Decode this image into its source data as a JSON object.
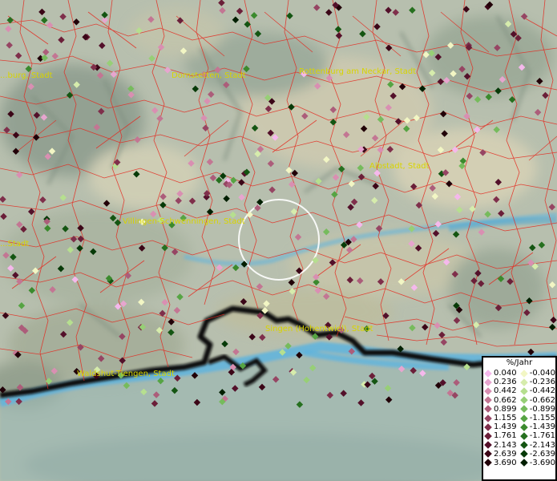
{
  "map": {
    "cities": [
      {
        "name": "...burg, Stadt"
      },
      {
        "name": "Dornstetten, Stadt"
      },
      {
        "name": "Rottenburg am Neckar, Stadt"
      },
      {
        "name": "Albstadt, Stadt"
      },
      {
        "name": "Villingen-Schwenningen, Stadt"
      },
      {
        "name": "...Stadt"
      },
      {
        "name": "Singen (Hohentwiel), Stadt"
      },
      {
        "name": "Waldshut-Tiengen, Stadt"
      }
    ]
  },
  "legend": {
    "title": "%/Jahr",
    "positive": [
      {
        "label": "0.040",
        "color": "#f5b8ec"
      },
      {
        "label": "0.236",
        "color": "#e7a5cf"
      },
      {
        "label": "0.442",
        "color": "#d98fb2"
      },
      {
        "label": "0.662",
        "color": "#c37693"
      },
      {
        "label": "0.899",
        "color": "#ac5d7a"
      },
      {
        "label": "1.155",
        "color": "#964563"
      },
      {
        "label": "1.439",
        "color": "#7f2f4b"
      },
      {
        "label": "1.761",
        "color": "#6b1f39"
      },
      {
        "label": "2.143",
        "color": "#53102a"
      },
      {
        "label": "2.639",
        "color": "#3b0617"
      },
      {
        "label": "3.690",
        "color": "#210008"
      }
    ],
    "negative": [
      {
        "label": "-0.040",
        "color": "#f2f6c4"
      },
      {
        "label": "-0.236",
        "color": "#d6ecac"
      },
      {
        "label": "-0.442",
        "color": "#b6df8f"
      },
      {
        "label": "-0.662",
        "color": "#97cf76"
      },
      {
        "label": "-0.899",
        "color": "#76bb5c"
      },
      {
        "label": "-1.155",
        "color": "#56a443"
      },
      {
        "label": "-1.439",
        "color": "#3b8a2d"
      },
      {
        "label": "-1.761",
        "color": "#26701f"
      },
      {
        "label": "-2.143",
        "color": "#145512"
      },
      {
        "label": "-2.639",
        "color": "#073a08"
      },
      {
        "label": "-3.690",
        "color": "#001f00"
      }
    ]
  },
  "colors": {
    "border_lines": "#e4291f",
    "water": "#5fb4de",
    "city_label": "#d8d400"
  }
}
